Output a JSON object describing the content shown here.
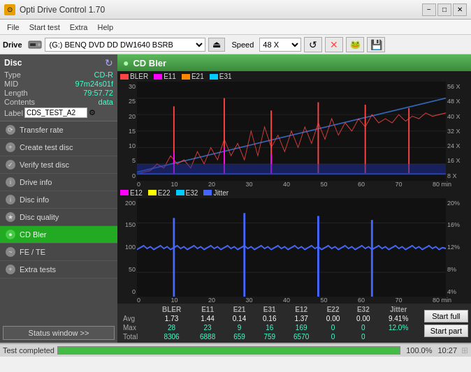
{
  "titleBar": {
    "icon": "⊙",
    "title": "Opti Drive Control 1.70",
    "minimize": "−",
    "maximize": "□",
    "close": "✕"
  },
  "menu": {
    "items": [
      "File",
      "Start test",
      "Extra",
      "Help"
    ]
  },
  "driveBar": {
    "label": "Drive",
    "driveValue": "(G:)  BENQ DVD DD DW1640 BSRB",
    "speedLabel": "Speed",
    "speedValue": "48 X"
  },
  "disc": {
    "title": "Disc",
    "type_label": "Type",
    "type_val": "CD-R",
    "mid_label": "MID",
    "mid_val": "97m24s01f",
    "length_label": "Length",
    "length_val": "79:57.72",
    "contents_label": "Contents",
    "contents_val": "data",
    "label_label": "Label",
    "label_val": "CDS_TEST_A2"
  },
  "sidebar": {
    "items": [
      {
        "id": "transfer-rate",
        "label": "Transfer rate",
        "active": false
      },
      {
        "id": "create-test-disc",
        "label": "Create test disc",
        "active": false
      },
      {
        "id": "verify-test-disc",
        "label": "Verify test disc",
        "active": false
      },
      {
        "id": "drive-info",
        "label": "Drive info",
        "active": false
      },
      {
        "id": "disc-info",
        "label": "Disc info",
        "active": false
      },
      {
        "id": "disc-quality",
        "label": "Disc quality",
        "active": false
      },
      {
        "id": "cd-bler",
        "label": "CD Bler",
        "active": true
      },
      {
        "id": "fe-te",
        "label": "FE / TE",
        "active": false
      },
      {
        "id": "extra-tests",
        "label": "Extra tests",
        "active": false
      }
    ]
  },
  "chart": {
    "title": "CD Bler",
    "top": {
      "legend": [
        {
          "color": "#ff4444",
          "label": "BLER"
        },
        {
          "color": "#ff00ff",
          "label": "E11"
        },
        {
          "color": "#ff8800",
          "label": "E21"
        },
        {
          "color": "#00ccff",
          "label": "E31"
        }
      ],
      "yLabels": [
        "30",
        "25",
        "20",
        "15",
        "10",
        "5",
        "0"
      ],
      "yRightLabels": [
        "56 X",
        "48 X",
        "40 X",
        "32 X",
        "24 X",
        "16 X",
        "8 X"
      ],
      "xLabels": [
        "0",
        "10",
        "20",
        "30",
        "40",
        "50",
        "60",
        "70",
        "80 min"
      ]
    },
    "bottom": {
      "legend": [
        {
          "color": "#ff00ff",
          "label": "E12"
        },
        {
          "color": "#ffff00",
          "label": "E22"
        },
        {
          "color": "#00ccff",
          "label": "E32"
        },
        {
          "color": "#4488ff",
          "label": "Jitter"
        }
      ],
      "yLabels": [
        "200",
        "150",
        "100",
        "50",
        "0"
      ],
      "yRightLabels": [
        "20%",
        "16%",
        "12%",
        "8%",
        "4%"
      ],
      "xLabels": [
        "0",
        "10",
        "20",
        "30",
        "40",
        "50",
        "60",
        "70",
        "80 min"
      ]
    }
  },
  "stats": {
    "headers": [
      "",
      "BLER",
      "E11",
      "E21",
      "E31",
      "E12",
      "E22",
      "E32",
      "Jitter"
    ],
    "rows": [
      {
        "label": "Avg",
        "bler": "1.73",
        "e11": "1.44",
        "e21": "0.14",
        "e31": "0.16",
        "e12": "1.37",
        "e22": "0.00",
        "e32": "0.00",
        "jitter": "9.41%"
      },
      {
        "label": "Max",
        "bler": "28",
        "e11": "23",
        "e21": "9",
        "e31": "16",
        "e12": "169",
        "e22": "0",
        "e32": "0",
        "jitter": "12.0%"
      },
      {
        "label": "Total",
        "bler": "8306",
        "e11": "6888",
        "e21": "659",
        "e31": "759",
        "e12": "6570",
        "e22": "0",
        "e32": "0",
        "jitter": ""
      }
    ],
    "startFull": "Start full",
    "startPart": "Start part"
  },
  "statusBar": {
    "statusWindowBtn": "Status window >>",
    "statusText": "Test completed",
    "progressValue": 100,
    "progressLabel": "100.0%",
    "time": "10:27"
  }
}
